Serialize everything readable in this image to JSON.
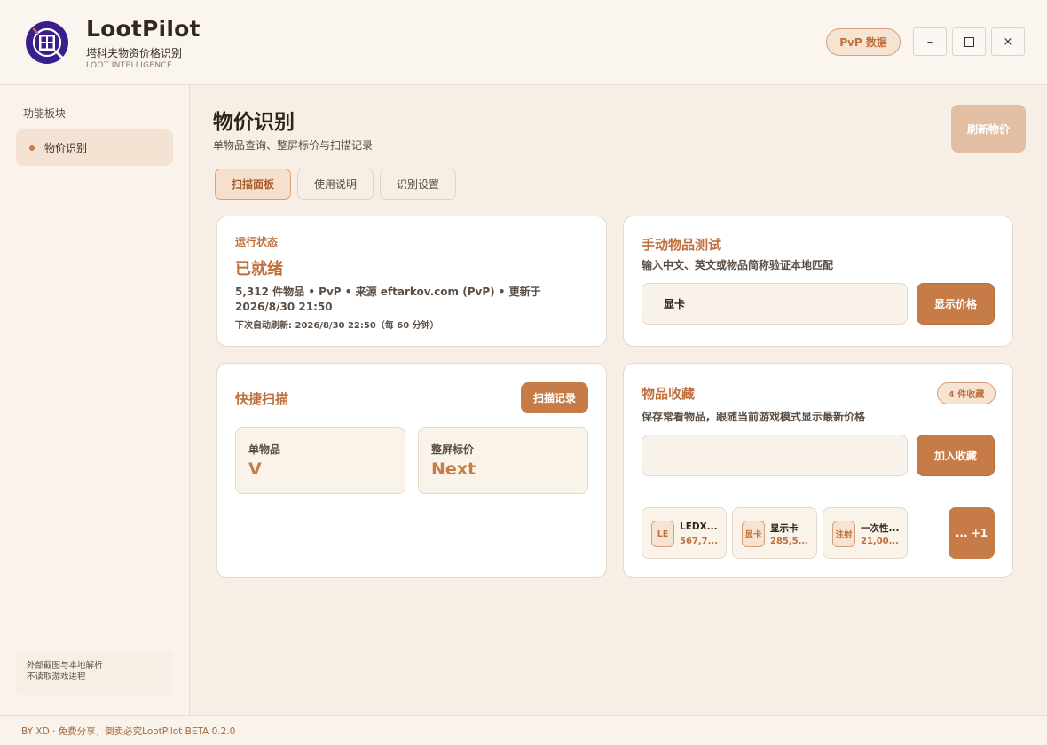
{
  "app": {
    "name": "LootPilot",
    "subtitle": "塔科夫物资价格识别",
    "tagline": "LOOT INTELLIGENCE",
    "mode_button": "PvP 数据",
    "window_controls": {
      "minimize": "–",
      "close": "×"
    }
  },
  "sidebar": {
    "heading": "功能板块",
    "items": [
      {
        "label": "物价识别",
        "active": true
      }
    ],
    "note_line1": "外部截图与本地解析",
    "note_line2": "不读取游戏进程"
  },
  "page": {
    "title": "物价识别",
    "subtitle": "单物品查询、整屏标价与扫描记录",
    "refresh_button": "刷新物价",
    "tabs": [
      {
        "label": "扫描面板",
        "active": true
      },
      {
        "label": "使用说明",
        "active": false
      },
      {
        "label": "识别设置",
        "active": false
      }
    ]
  },
  "status": {
    "label": "运行状态",
    "value": "已就绪",
    "info": "5,312 件物品 • PvP • 来源 eftarkov.com (PvP) • 更新于 2026/8/30 21:50",
    "next_refresh": "下次自动刷新: 2026/8/30 22:50（每 60 分钟）"
  },
  "manual": {
    "title": "手动物品测试",
    "desc": "输入中文、英文或物品简称验证本地匹配",
    "input_value": "显卡",
    "button": "显示价格"
  },
  "quick_scan": {
    "title": "快捷扫描",
    "log_button": "扫描记录",
    "modes": [
      {
        "label": "单物品",
        "key": "V"
      },
      {
        "label": "整屏标价",
        "key": "Next"
      }
    ]
  },
  "favorites": {
    "title": "物品收藏",
    "badge": "4 件收藏",
    "desc": "保存常看物品，跟随当前游戏模式显示最新价格",
    "input_value": "",
    "add_button": "加入收藏",
    "items": [
      {
        "icon": "LE",
        "name": "LEDX...",
        "price": "567,7..."
      },
      {
        "icon": "显卡",
        "name": "显示卡",
        "price": "285,5..."
      },
      {
        "icon": "注射",
        "name": "一次性...",
        "price": "21,00..."
      }
    ],
    "more": "... +1"
  },
  "footer": {
    "text": "BY XD · 免费分享，倒卖必究LootPilot BETA 0.2.0"
  },
  "colors": {
    "accent": "#c77c48",
    "accent_text": "#c0703c",
    "background": "#f7efe5",
    "logo": "#3a1f8c"
  }
}
